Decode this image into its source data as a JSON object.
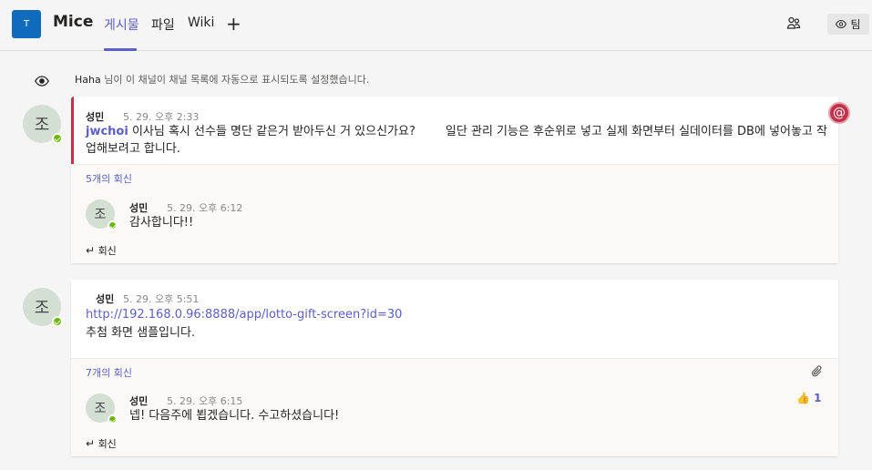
{
  "header": {
    "team_initial": "T",
    "channel_name": "Mice",
    "tabs": [
      {
        "label": "게시물"
      },
      {
        "label": "파일"
      },
      {
        "label": "Wiki"
      }
    ],
    "add_tab_symbol": "+",
    "team_button_label": "팀"
  },
  "system_message": {
    "user": "Haha",
    "text": " 님이 이 채널이 채널 목록에 자동으로 표시되도록 설정했습니다."
  },
  "threads": [
    {
      "author": "성민",
      "time": "5. 29. 오후 2:33",
      "avatar_initial": "조",
      "mention": "jwchoi",
      "text_line1": " 이사님 혹시 선수들 명단 같은거 받아두신 거 있으신가요?        일단 관리 기능은 후순위로 넣고 실제 화면부터 실데이터를 DB에 넣어놓고 작",
      "text_line2": "업해보려고 합니다.",
      "reply_count": "5개의 회신",
      "reply": {
        "author": "성민",
        "time": "5. 29. 오후 6:12",
        "avatar_initial": "조",
        "text": "감사합니다!!"
      },
      "reply_button": "회신"
    },
    {
      "author": "성민",
      "time": "5. 29. 오후 5:51",
      "avatar_initial": "조",
      "link": "http://192.168.0.96:8888/app/lotto-gift-screen?id=30",
      "text": "추첨 화면 샘플입니다.",
      "reply_count": "7개의 회신",
      "reply": {
        "author": "성민",
        "time": "5. 29. 오후 6:15",
        "avatar_initial": "조",
        "text": "넵! 다음주에 뵙겠습니다. 수고하셨습니다!",
        "reaction_emoji": "👍",
        "reaction_count": "1"
      },
      "reply_button": "회신"
    }
  ],
  "colors": {
    "accent": "#5b5fc7",
    "mention_bar": "#c4314b",
    "presence": "#6bb700",
    "team_avatar": "#0f6cbd"
  },
  "icons": [
    "people-icon",
    "eye-icon",
    "at-mention-icon",
    "reply-arrow-icon",
    "paperclip-icon",
    "thumbs-up-icon"
  ]
}
